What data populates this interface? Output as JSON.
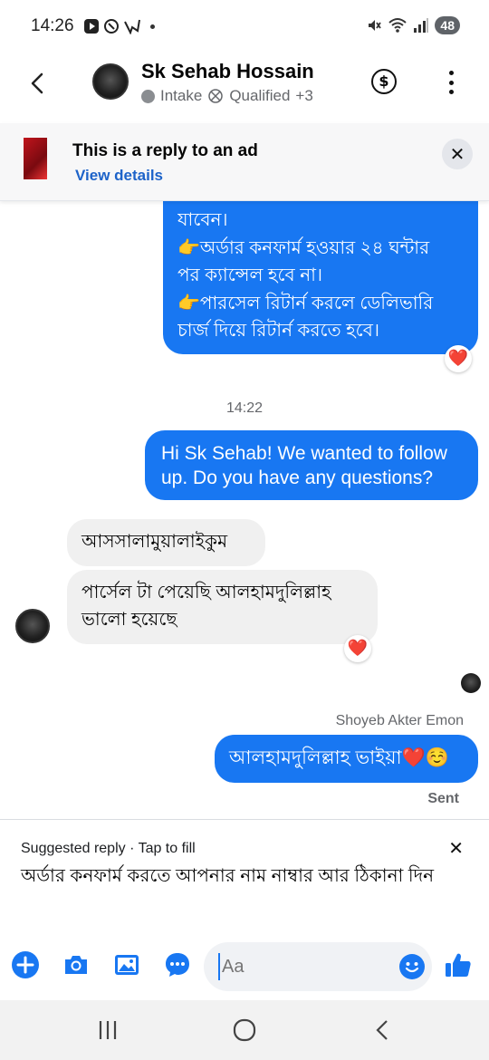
{
  "status_bar": {
    "time": "14:26",
    "battery": "48"
  },
  "header": {
    "name": "Sk Sehab Hossain",
    "label_1": "Intake",
    "label_2": "Qualified",
    "label_more": "+3",
    "dollar": "$"
  },
  "ad_banner": {
    "title": "This is a reply to an ad",
    "link": "View details",
    "close": "✕"
  },
  "messages": {
    "m1_lines": [
      "যাবেন।",
      "👉অর্ডার কনফার্ম হওয়ার ২৪ ঘন্টার",
      "পর ক্যান্সেল হবে না।",
      "👉পারসেল রিটার্ন করলে ডেলিভারি",
      "চার্জ দিয়ে রিটার্ন করতে হবে।"
    ],
    "m1_reaction": "❤️",
    "timestamp": "14:22",
    "m2": "Hi Sk Sehab! We wanted to follow up. Do you have any questions?",
    "m3": "আসসালামুয়ালাইকুম",
    "m4": "পার্সেল টা পেয়েছি আলহামদুলিল্লাহ ভালো হয়েছে",
    "m4_reaction": "❤️",
    "sender": "Shoyeb Akter Emon",
    "m5": "আলহামদুলিল্লাহ ভাইয়া❤️☺️",
    "sent": "Sent"
  },
  "suggested": {
    "heading": "Suggested reply · Tap to fill",
    "close": "✕",
    "text": "অর্ডার কনফার্ম করতে আপনার নাম নাম্বার আর ঠিকানা দিন"
  },
  "composer": {
    "placeholder": "Aa"
  },
  "colors": {
    "accent": "#1877f2",
    "bubble_in": "#f0f0f0",
    "heart": "#e41e3f"
  }
}
